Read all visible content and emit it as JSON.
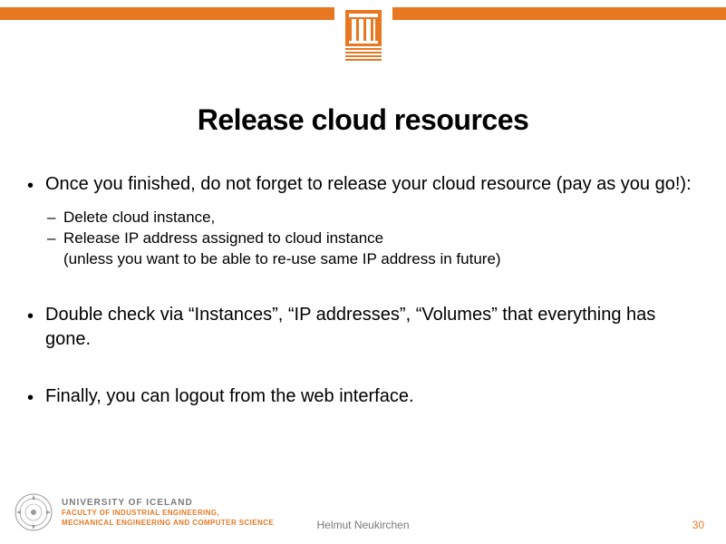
{
  "title": "Release cloud resources",
  "bullets": {
    "b1": "Once you finished, do not forget to release your cloud resource (pay as you go!):",
    "b1_subs": {
      "s1": "Delete cloud instance,",
      "s2a": "Release IP address assigned to cloud instance",
      "s2b": "(unless you want to be able to re-use same IP address in future)"
    },
    "b2": "Double check via “Instances”, “IP addresses”, “Volumes” that everything has gone.",
    "b3": "Finally, you can logout from the web interface."
  },
  "footer": {
    "university": "UNIVERSITY OF ICELAND",
    "faculty_line1": "FACULTY OF INDUSTRIAL ENGINEERING,",
    "faculty_line2": "MECHANICAL ENGINEERING AND COMPUTER SCIENCE",
    "author": "Helmut Neukirchen",
    "page": "30"
  },
  "colors": {
    "accent": "#e87722"
  }
}
